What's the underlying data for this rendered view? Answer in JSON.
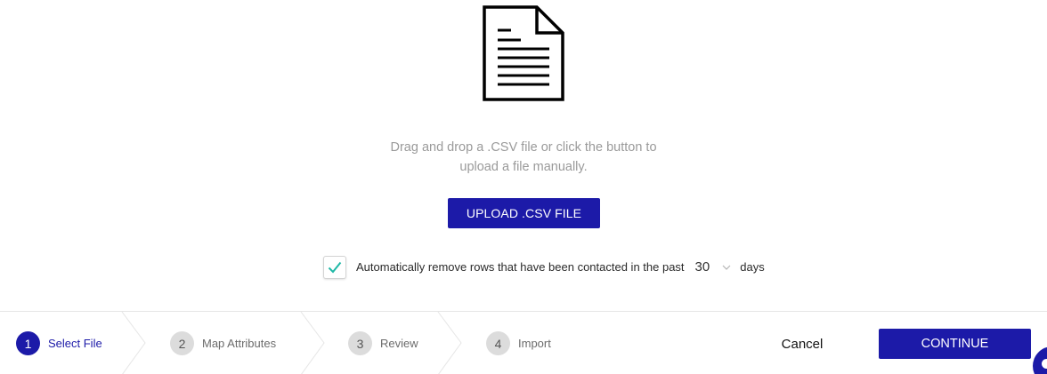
{
  "dropzone": {
    "icon": "document-icon",
    "text_line1": "Drag and drop a .CSV file or click the button to",
    "text_line2": "upload a file manually.",
    "upload_label": "UPLOAD .CSV FILE"
  },
  "options": {
    "auto_remove_checked": true,
    "auto_remove_label": "Automatically remove rows that have been contacted in the past",
    "days_value": "30",
    "days_suffix": "days"
  },
  "steps": [
    {
      "number": "1",
      "label": "Select File",
      "active": true
    },
    {
      "number": "2",
      "label": "Map Attributes",
      "active": false
    },
    {
      "number": "3",
      "label": "Review",
      "active": false
    },
    {
      "number": "4",
      "label": "Import",
      "active": false
    }
  ],
  "actions": {
    "cancel_label": "Cancel",
    "continue_label": "CONTINUE"
  },
  "colors": {
    "primary": "#1c1aa8",
    "check": "#1fb8a6",
    "muted_text": "#9a9a9a"
  }
}
